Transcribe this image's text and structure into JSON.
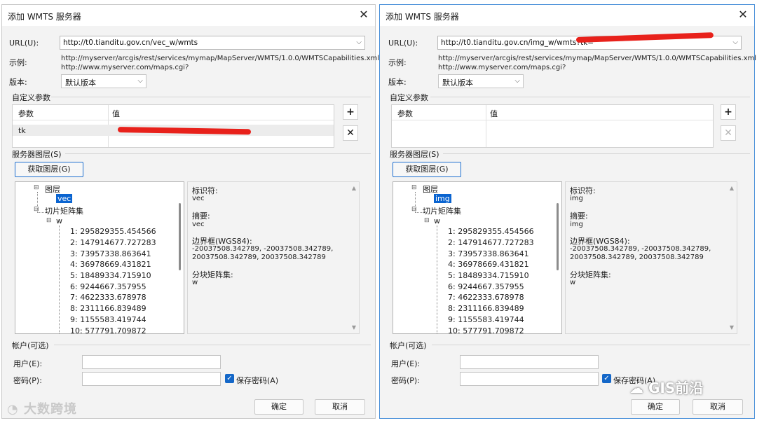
{
  "left": {
    "title": "添加 WMTS 服务器",
    "close": "✕",
    "url_label": "URL(U):",
    "url_value": "http://t0.tianditu.gov.cn/vec_w/wmts",
    "example_label": "示例:",
    "example_line1": "http://myserver/arcgis/rest/services/mymap/MapServer/WMTS/1.0.0/WMTSCapabilities.xml",
    "example_line2": "http://www.myserver.com/maps.cgi?",
    "version_label": "版本:",
    "version_value": "默认版本",
    "custom_params_label": "自定义参数",
    "col_param": "参数",
    "col_value": "值",
    "param_row_name": "tk",
    "add_icon": "+",
    "remove_icon": "✕",
    "server_layers_label": "服务器图层(S)",
    "fetch_button": "获取图层(G)",
    "tree": {
      "layers": "图层",
      "layer_name": "vec",
      "tile_matrix_sets": "切片矩阵集",
      "set_name": "w",
      "levels": [
        "1: 295829355.454566",
        "2: 147914677.727283",
        "3: 73957338.863641",
        "4: 36978669.431821",
        "5: 18489334.715910",
        "6: 9244667.357955",
        "7: 4622333.678978",
        "8: 2311166.839489",
        "9: 1155583.419744",
        "10: 577791.709872"
      ]
    },
    "details": {
      "identifier_label": "标识符:",
      "identifier_value": "vec",
      "abstract_label": "摘要:",
      "abstract_value": "vec",
      "bbox_label": "边界框(WGS84):",
      "bbox_line1": "-20037508.342789, -20037508.342789,",
      "bbox_line2": "20037508.342789, 20037508.342789",
      "tms_label": "分块矩阵集:",
      "tms_value": "w"
    },
    "account_label": "帐户(可选)",
    "user_label": "用户(E):",
    "password_label": "密码(P):",
    "save_password": "保存密码(A)",
    "ok": "确定",
    "cancel": "取消"
  },
  "right": {
    "title": "添加 WMTS 服务器",
    "close": "✕",
    "url_label": "URL(U):",
    "url_value": "http://t0.tianditu.gov.cn/img_w/wmts?tk=",
    "example_label": "示例:",
    "example_line1": "http://myserver/arcgis/rest/services/mymap/MapServer/WMTS/1.0.0/WMTSCapabilities.xml",
    "example_line2": "http://www.myserver.com/maps.cgi?",
    "version_label": "版本:",
    "version_value": "默认版本",
    "custom_params_label": "自定义参数",
    "col_param": "参数",
    "col_value": "值",
    "add_icon": "+",
    "remove_icon": "✕",
    "server_layers_label": "服务器图层(S)",
    "fetch_button": "获取图层(G)",
    "tree": {
      "layers": "图层",
      "layer_name": "img",
      "tile_matrix_sets": "切片矩阵集",
      "set_name": "w",
      "levels": [
        "1: 295829355.454566",
        "2: 147914677.727283",
        "3: 73957338.863641",
        "4: 36978669.431821",
        "5: 18489334.715910",
        "6: 9244667.357955",
        "7: 4622333.678978",
        "8: 2311166.839489",
        "9: 1155583.419744",
        "10: 577791.709872"
      ]
    },
    "details": {
      "identifier_label": "标识符:",
      "identifier_value": "img",
      "abstract_label": "摘要:",
      "abstract_value": "img",
      "bbox_label": "边界框(WGS84):",
      "bbox_line1": "-20037508.342789, -20037508.342789,",
      "bbox_line2": "20037508.342789, 20037508.342789",
      "tms_label": "分块矩阵集:",
      "tms_value": "w"
    },
    "account_label": "帐户(可选)",
    "user_label": "用户(E):",
    "password_label": "密码(P):",
    "save_password": "保存密码(A)",
    "ok": "确定",
    "cancel": "取消"
  },
  "watermarks": {
    "left": "大数跨境",
    "right": "GIS前沿"
  },
  "colors": {
    "accent": "#1e6fd0",
    "selection": "#0a64d0",
    "redaction": "#e8211b"
  }
}
